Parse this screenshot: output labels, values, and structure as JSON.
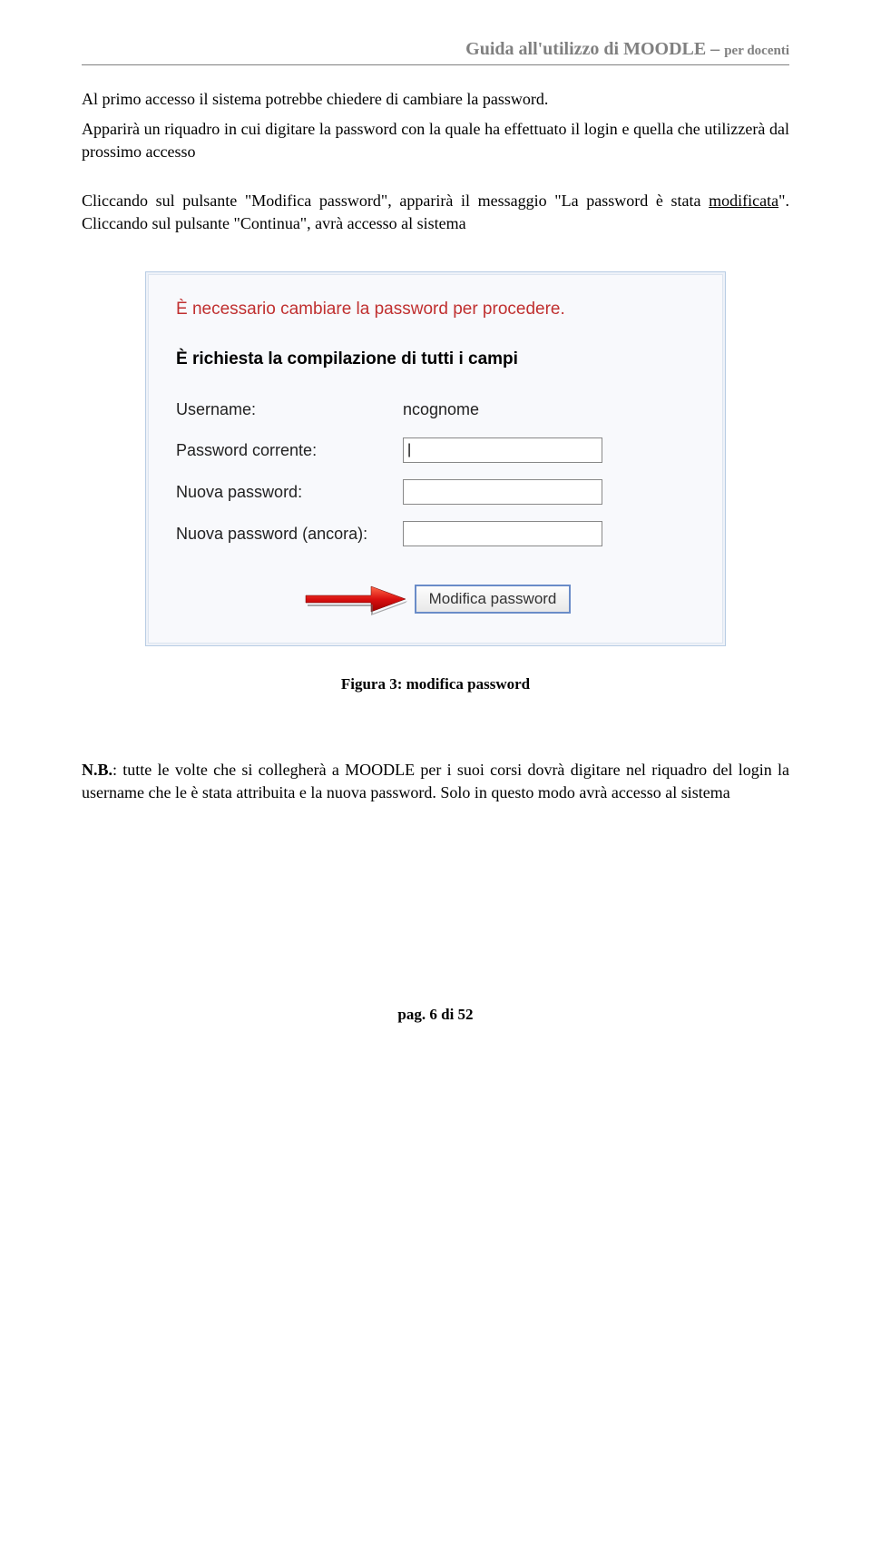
{
  "header": {
    "main": "Guida all'utilizzo di MOODLE – ",
    "sub": "per docenti"
  },
  "paragraphs": {
    "p1": "Al primo accesso il sistema potrebbe chiedere di cambiare la password.",
    "p2": "Apparirà un riquadro in cui digitare la password con la quale ha effettuato il login e quella che utilizzerà dal prossimo accesso",
    "p3_a": "Cliccando sul pulsante \"Modifica password\", apparirà il messaggio \"La password è stata ",
    "p3_b": "modificata",
    "p3_c": "\". Cliccando sul pulsante \"Continua\", avrà accesso al sistema"
  },
  "form": {
    "notify": "È necessario cambiare la password per procedere.",
    "required": "È richiesta la compilazione di tutti i campi",
    "username_label": "Username:",
    "username_value": "ncognome",
    "current_pw_label": "Password corrente:",
    "current_pw_value": "|",
    "new_pw_label": "Nuova password:",
    "new_pw2_label": "Nuova password (ancora):",
    "submit_label": "Modifica password"
  },
  "caption": "Figura 3: modifica password",
  "nb": {
    "prefix": "N.B.",
    "text": ": tutte le volte che si collegherà a MOODLE per i suoi corsi dovrà digitare nel riquadro del login la username che le è stata attribuita e la nuova password. Solo in questo modo avrà accesso al sistema"
  },
  "footer": "pag. 6 di 52"
}
